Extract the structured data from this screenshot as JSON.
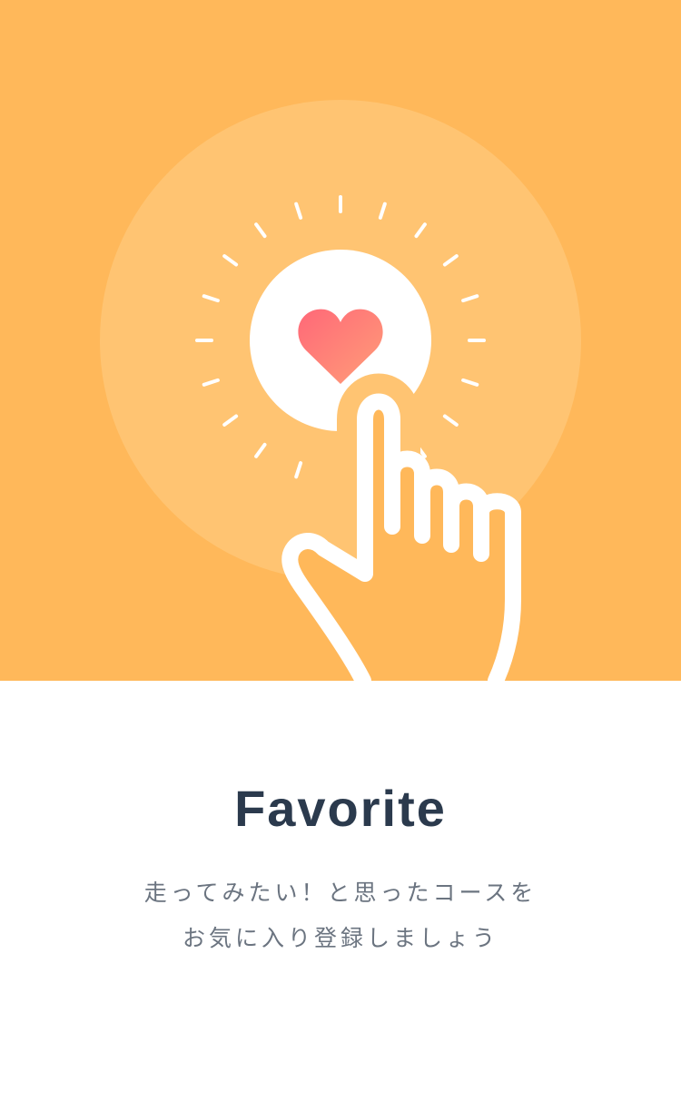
{
  "onboarding": {
    "title": "Favorite",
    "description_lines": [
      "走ってみたい！と思ったコースを",
      "お気に入り登録しましょう"
    ]
  },
  "illustration": {
    "icon": "heart-icon",
    "gesture": "pointing-hand-icon"
  },
  "colors": {
    "hero_background": "#FFB85A",
    "halo": "#FFC472",
    "heart_gradient_start": "#FF6878",
    "heart_gradient_end": "#FF9E78",
    "title_text": "#2B3A4D",
    "body_text": "#6B7480"
  }
}
